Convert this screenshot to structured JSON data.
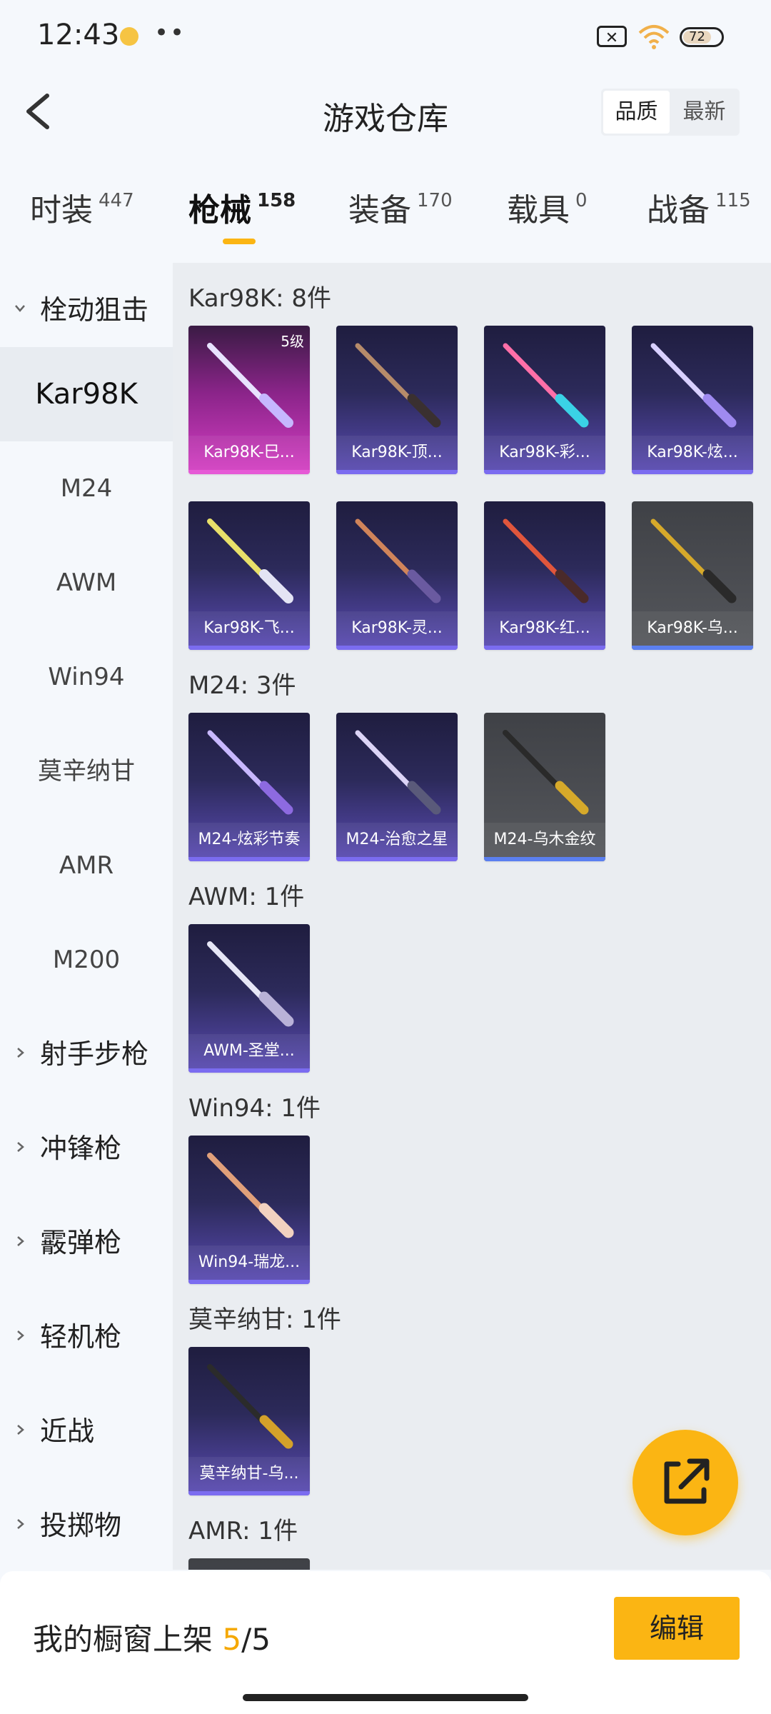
{
  "status_bar": {
    "time": "12:43",
    "battery": "72"
  },
  "header": {
    "title": "游戏仓库",
    "sort_options": [
      "品质",
      "最新"
    ],
    "sort_selected": "品质"
  },
  "tabs": [
    {
      "label": "时装",
      "count": "447"
    },
    {
      "label": "枪械",
      "count": "158",
      "active": true
    },
    {
      "label": "装备",
      "count": "170"
    },
    {
      "label": "载具",
      "count": "0"
    },
    {
      "label": "战备",
      "count": "115"
    }
  ],
  "sidebar": {
    "group_open": "栓动狙击",
    "items": [
      "Kar98K",
      "M24",
      "AWM",
      "Win94",
      "莫辛纳甘",
      "AMR",
      "M200"
    ],
    "selected": "Kar98K",
    "groups_collapsed": [
      "射手步枪",
      "冲锋枪",
      "霰弹枪",
      "轻机枪",
      "近战",
      "投掷物"
    ]
  },
  "sections": [
    {
      "title": "Kar98K: 8件",
      "items": [
        {
          "name": "Kar98K-巳...",
          "rarity": "pink",
          "badge": "5级"
        },
        {
          "name": "Kar98K-顶...",
          "rarity": "purple"
        },
        {
          "name": "Kar98K-彩...",
          "rarity": "purple"
        },
        {
          "name": "Kar98K-炫...",
          "rarity": "purple"
        },
        {
          "name": "Kar98K-飞...",
          "rarity": "purple"
        },
        {
          "name": "Kar98K-灵...",
          "rarity": "purple"
        },
        {
          "name": "Kar98K-红...",
          "rarity": "purple"
        },
        {
          "name": "Kar98K-乌...",
          "rarity": "gray"
        }
      ]
    },
    {
      "title": "M24: 3件",
      "items": [
        {
          "name": "M24-炫彩节奏",
          "rarity": "purple"
        },
        {
          "name": "M24-治愈之星",
          "rarity": "purple"
        },
        {
          "name": "M24-乌木金纹",
          "rarity": "gray"
        }
      ]
    },
    {
      "title": "AWM: 1件",
      "items": [
        {
          "name": "AWM-圣堂...",
          "rarity": "purple"
        }
      ]
    },
    {
      "title": "Win94: 1件",
      "items": [
        {
          "name": "Win94-瑞龙...",
          "rarity": "purple"
        }
      ]
    },
    {
      "title": "莫辛纳甘: 1件",
      "items": [
        {
          "name": "莫辛纳甘-乌...",
          "rarity": "purple"
        }
      ]
    },
    {
      "title": "AMR: 1件",
      "items": []
    }
  ],
  "bottom": {
    "label": "我的橱窗上架",
    "current": "5",
    "total": "/5",
    "edit_label": "编辑"
  },
  "colors": {
    "accent": "#fbb513",
    "epic": "#d63fc4",
    "rare": "#5a4bb4",
    "common": "#55575c"
  }
}
